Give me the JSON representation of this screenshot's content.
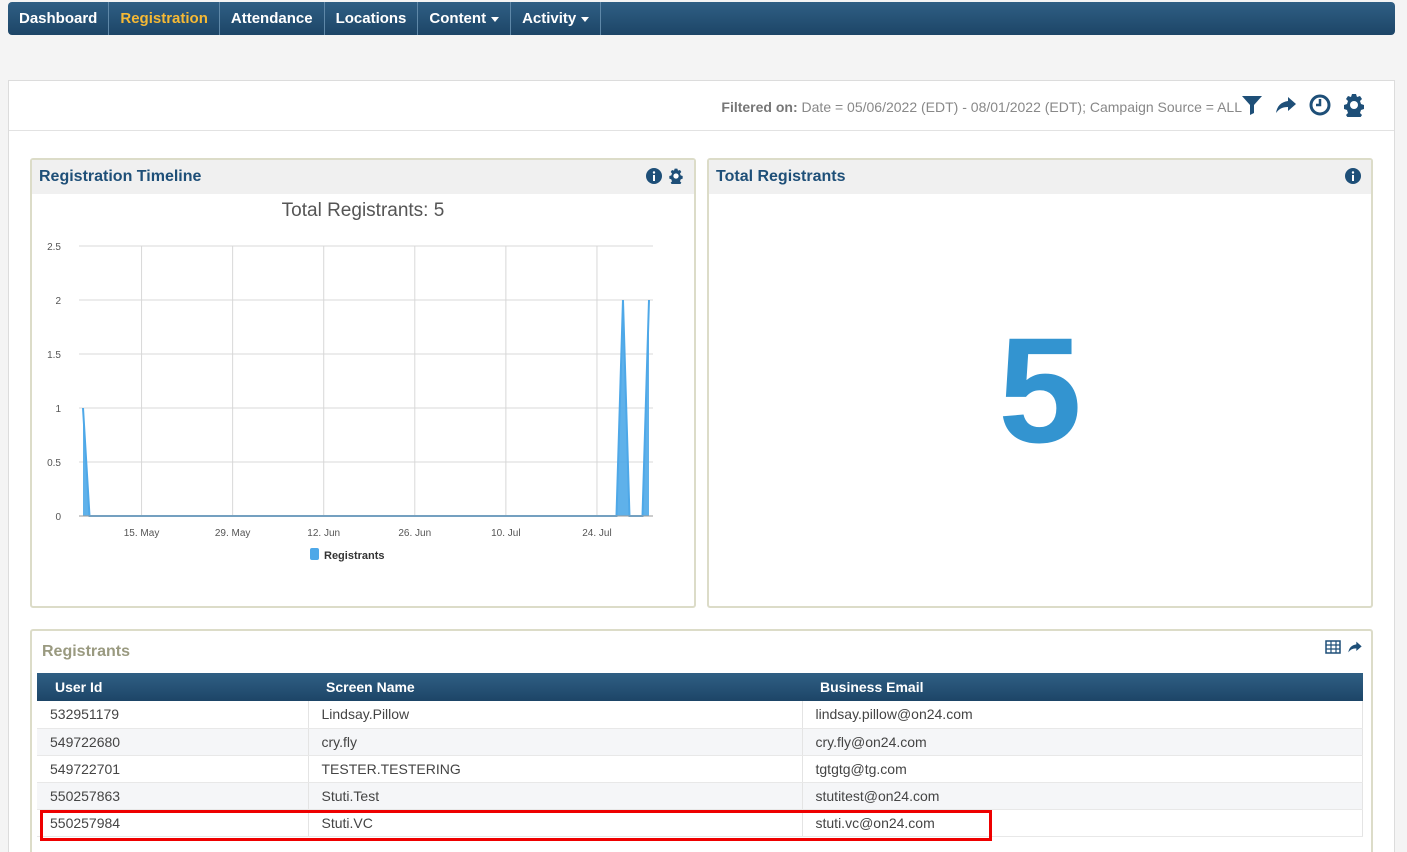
{
  "nav": {
    "items": [
      {
        "label": "Dashboard",
        "caret": false,
        "active": false
      },
      {
        "label": "Registration",
        "caret": false,
        "active": true
      },
      {
        "label": "Attendance",
        "caret": false,
        "active": false
      },
      {
        "label": "Locations",
        "caret": false,
        "active": false
      },
      {
        "label": "Content",
        "caret": true,
        "active": false
      },
      {
        "label": "Activity",
        "caret": true,
        "active": false
      }
    ]
  },
  "filter": {
    "label": "Filtered on:",
    "text": " Date = 05/06/2022 (EDT) - 08/01/2022 (EDT); Campaign Source = ALL",
    "icons": [
      "filter-icon",
      "share-icon",
      "clock-icon",
      "gear-icon"
    ]
  },
  "timeline": {
    "title": "Registration Timeline",
    "icons": [
      "info-icon",
      "gear-icon"
    ]
  },
  "total": {
    "title": "Total Registrants",
    "value": "5",
    "icons": [
      "info-icon"
    ]
  },
  "registrants": {
    "title": "Registrants",
    "icons": [
      "table-icon",
      "share-icon"
    ],
    "columns": [
      "User Id",
      "Screen Name",
      "Business Email"
    ],
    "rows": [
      [
        "532951179",
        "Lindsay.Pillow",
        "lindsay.pillow@on24.com"
      ],
      [
        "549722680",
        "cry.fly",
        "cry.fly@on24.com"
      ],
      [
        "549722701",
        "TESTER.TESTERING",
        "tgtgtg@tg.com"
      ],
      [
        "550257863",
        "Stuti.Test",
        "stutitest@on24.com"
      ],
      [
        "550257984",
        "Stuti.VC",
        "stuti.vc@on24.com"
      ]
    ]
  },
  "colors": {
    "nav_bg": "#1d4567",
    "nav_active": "#f5b935",
    "accent": "#3394d0",
    "highlight": "#ee0000"
  },
  "chart_data": {
    "type": "area",
    "title": "Total Registrants: 5",
    "xlabel": "",
    "ylabel": "",
    "x_ticks": [
      "15. May",
      "29. May",
      "12. Jun",
      "26. Jun",
      "10. Jul",
      "24. Jul"
    ],
    "y_ticks": [
      "0",
      "0.5",
      "1",
      "1.5",
      "2",
      "2.5"
    ],
    "ylim": [
      0,
      2.5
    ],
    "xlim": [
      "2022-05-06",
      "2022-08-01"
    ],
    "legend": "bottom",
    "grid": true,
    "series": [
      {
        "name": "Registrants",
        "color": "#4ea8e8",
        "points": [
          {
            "x": "2022-05-06",
            "y": 1
          },
          {
            "x": "2022-05-07",
            "y": 0
          },
          {
            "x": "2022-07-27",
            "y": 0
          },
          {
            "x": "2022-07-28",
            "y": 2
          },
          {
            "x": "2022-07-29",
            "y": 0
          },
          {
            "x": "2022-07-31",
            "y": 0
          },
          {
            "x": "2022-08-01",
            "y": 2
          }
        ]
      }
    ]
  }
}
